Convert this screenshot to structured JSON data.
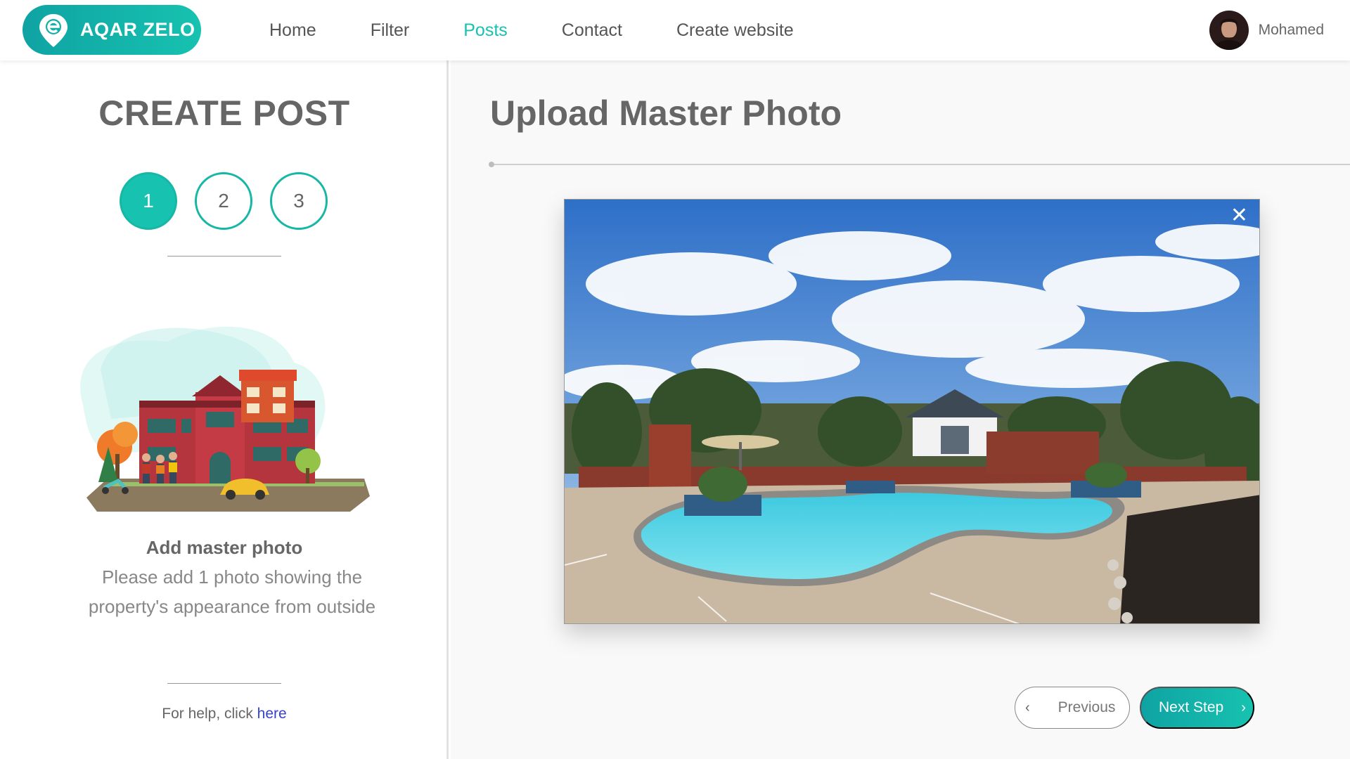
{
  "brand": {
    "name": "AQAR ZELO",
    "logo_icon": "map-pin-e-icon",
    "color": "#17c2b0"
  },
  "nav": {
    "items": [
      {
        "label": "Home",
        "active": false
      },
      {
        "label": "Filter",
        "active": false
      },
      {
        "label": "Posts",
        "active": true
      },
      {
        "label": "Contact",
        "active": false
      },
      {
        "label": "Create website",
        "active": false
      }
    ]
  },
  "user": {
    "name": "Mohamed"
  },
  "sidebar": {
    "title": "CREATE POST",
    "steps": [
      "1",
      "2",
      "3"
    ],
    "active_step": "1",
    "info_title": "Add master photo",
    "info_text": "Please add 1 photo showing the property's appearance from outside",
    "help_prefix": "For help, click ",
    "help_link": "here"
  },
  "main": {
    "title": "Upload Master Photo",
    "close_symbol": "✕",
    "prev_label": "Previous",
    "prev_icon": "‹",
    "next_label": "Next Step",
    "next_icon": "›"
  }
}
